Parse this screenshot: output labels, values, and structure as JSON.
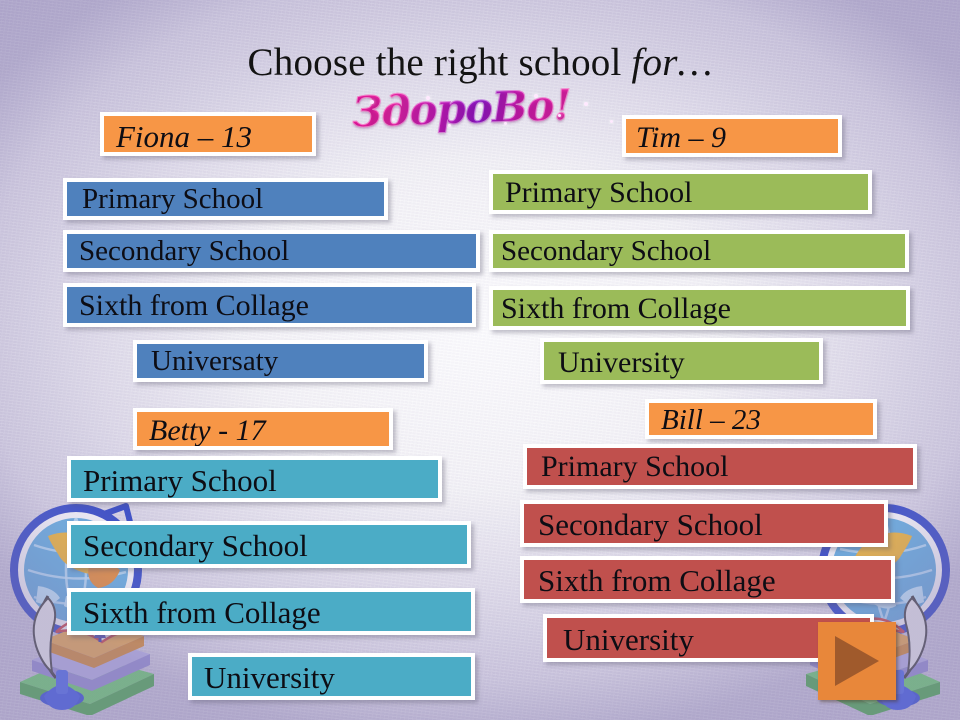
{
  "slide": {
    "title_plain": "Choose  the right school ",
    "title_italic": "for…",
    "wordart": "ЗдороВо!",
    "background_color": "#e8e5f0"
  },
  "colors": {
    "name_box": "#F79646",
    "fiona": "#4F81BD",
    "tim": "#9BBB59",
    "betty": "#4BACC6",
    "bill": "#C0504D",
    "play_button": "#E8873A",
    "play_triangle": "#A05A2C"
  },
  "people": [
    {
      "id": "fiona",
      "name_label": "Fiona – 13",
      "stages": [
        "Primary School",
        "Secondary School",
        "Sixth from Collage",
        "Universaty"
      ]
    },
    {
      "id": "tim",
      "name_label": "Tim – 9",
      "stages": [
        "Primary School",
        "Secondary School",
        "Sixth from Collage",
        "University"
      ]
    },
    {
      "id": "betty",
      "name_label": "Betty - 17",
      "stages": [
        "Primary School",
        "Secondary School",
        "Sixth from Collage",
        "University"
      ]
    },
    {
      "id": "bill",
      "name_label": "Bill – 23",
      "stages": [
        "Primary School",
        "Secondary School",
        "Sixth from Collage",
        "University"
      ]
    }
  ],
  "nav": {
    "next_label": "▶"
  },
  "decor": {
    "left_clipart": "globe-books-quill-icon",
    "right_clipart": "globe-books-quill-icon"
  }
}
